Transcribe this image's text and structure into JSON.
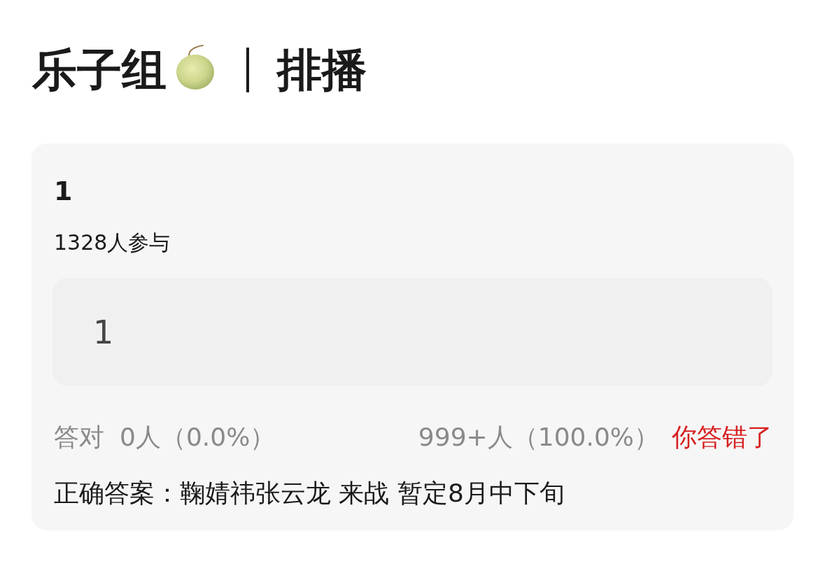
{
  "header": {
    "group": "乐子组",
    "section": "排播"
  },
  "question": {
    "title": "1",
    "participants": "1328人参与",
    "answer": "1",
    "stats": {
      "correct_label": "答对",
      "correct_count": "0人（0.0%）",
      "wrong_count": "999+人（100.0%）",
      "result": "你答错了",
      "result_correct": false
    },
    "correct_answer": "正确答案：鞠婧祎张云龙 来战 暂定8月中下旬"
  }
}
